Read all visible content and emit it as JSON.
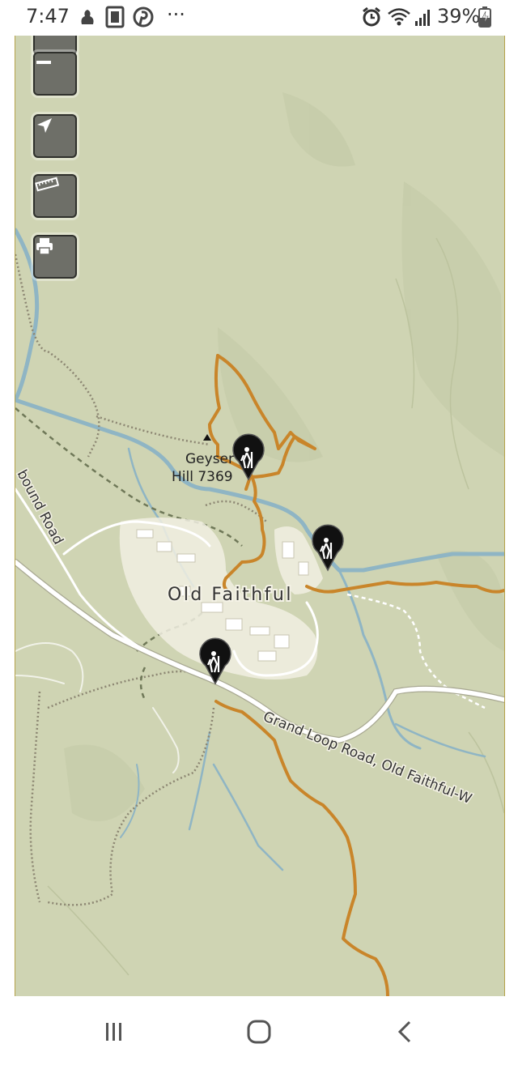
{
  "status_bar": {
    "time": "7:47",
    "left_icons": [
      "app-icon",
      "cards-icon",
      "pinterest-icon"
    ],
    "more": "···",
    "battery": "39%",
    "right_icons": [
      "alarm-icon",
      "wifi-icon",
      "signal-icon",
      "battery-charging-icon"
    ]
  },
  "map": {
    "controls": [
      "zoom-in",
      "zoom-out",
      "locate",
      "measure",
      "print"
    ],
    "labels": {
      "peak_name_1": "Geyser",
      "peak_name_2": "Hill 7369",
      "town": "Old Faithful",
      "road_main": "Grand Loop Road, Old Faithful-W",
      "road_side": "bound Road"
    },
    "trailheads": 3
  },
  "nav_bar": {
    "buttons": [
      "recent-apps",
      "home",
      "back"
    ]
  },
  "colors": {
    "map_bg": "#cfd4b3",
    "trail": "#c9852a",
    "water": "#8fb5c4",
    "road": "#ffffff",
    "town": "#f1efe2"
  }
}
